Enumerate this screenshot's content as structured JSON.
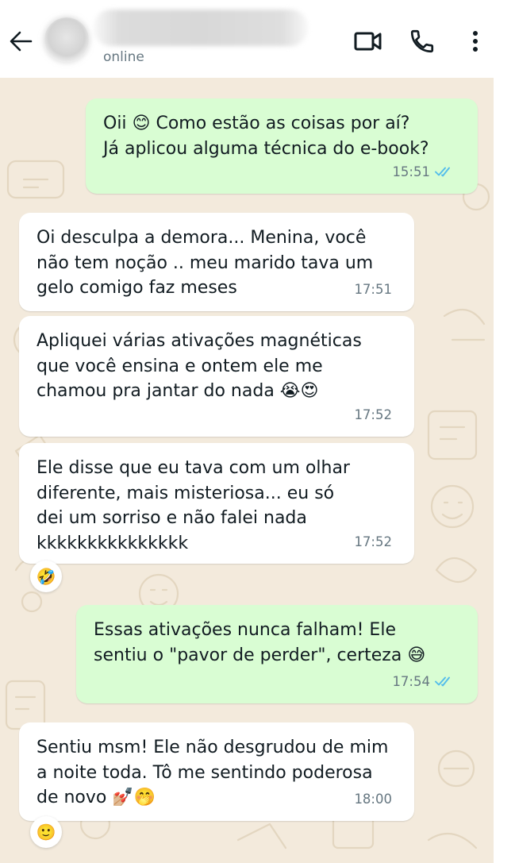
{
  "header": {
    "contact_name": "",
    "status": "online"
  },
  "messages": [
    {
      "direction": "outgoing",
      "lines": [
        "Oii 😊 Como estão as coisas por aí?",
        "Já aplicou alguma técnica do e-book?"
      ],
      "time": "15:51",
      "ticks": "read"
    },
    {
      "direction": "incoming",
      "lines": [
        "Oi desculpa a demora... Menina, você",
        "não tem noção .. meu marido tava um",
        "gelo comigo faz meses"
      ],
      "time": "17:51"
    },
    {
      "direction": "incoming",
      "lines": [
        "Apliquei várias ativações magnéticas",
        "que você ensina e ontem ele me",
        "chamou pra jantar do nada 😭😍"
      ],
      "time": "17:52"
    },
    {
      "direction": "incoming",
      "lines": [
        "Ele disse que eu tava com um olhar",
        "diferente, mais misteriosa... eu só",
        "dei um sorriso e não falei nada",
        "kkkkkkkkkkkkkkk"
      ],
      "time": "17:52",
      "reaction": "🤣"
    },
    {
      "direction": "outgoing",
      "lines": [
        "Essas ativações nunca falham! Ele",
        "sentiu o \"pavor de perder\", certeza 😅"
      ],
      "time": "17:54",
      "ticks": "read"
    },
    {
      "direction": "incoming",
      "lines": [
        "Sentiu msm! Ele não desgrudou de mim",
        "a noite toda. Tô me sentindo poderosa",
        "de novo 💅🏼🤭"
      ],
      "time": "18:00",
      "reaction": "🙂"
    }
  ],
  "colors": {
    "outgoing_bubble": "#d9fdd3",
    "incoming_bubble": "#ffffff",
    "chat_background": "#f3eadc",
    "read_ticks": "#53bdeb",
    "meta_text": "#667781"
  },
  "icons": [
    "back-arrow-icon",
    "video-call-icon",
    "voice-call-icon",
    "more-options-icon",
    "double-check-icon"
  ]
}
